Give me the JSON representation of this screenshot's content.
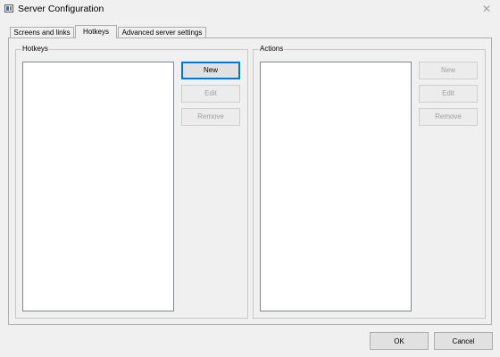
{
  "window": {
    "title": "Server Configuration",
    "close_glyph": "✕"
  },
  "tabs": [
    {
      "label": "Screens and links",
      "active": false
    },
    {
      "label": "Hotkeys",
      "active": true
    },
    {
      "label": "Advanced server settings",
      "active": false
    }
  ],
  "hotkeys_group": {
    "title": "Hotkeys",
    "items": [],
    "buttons": {
      "new": {
        "label": "New",
        "enabled": true
      },
      "edit": {
        "label": "Edit",
        "enabled": false
      },
      "remove": {
        "label": "Remove",
        "enabled": false
      }
    }
  },
  "actions_group": {
    "title": "Actions",
    "items": [],
    "buttons": {
      "new": {
        "label": "New",
        "enabled": false
      },
      "edit": {
        "label": "Edit",
        "enabled": false
      },
      "remove": {
        "label": "Remove",
        "enabled": false
      }
    }
  },
  "dialog_buttons": {
    "ok": "OK",
    "cancel": "Cancel"
  },
  "icons": {
    "app": "app-window-icon",
    "close": "close-icon"
  }
}
